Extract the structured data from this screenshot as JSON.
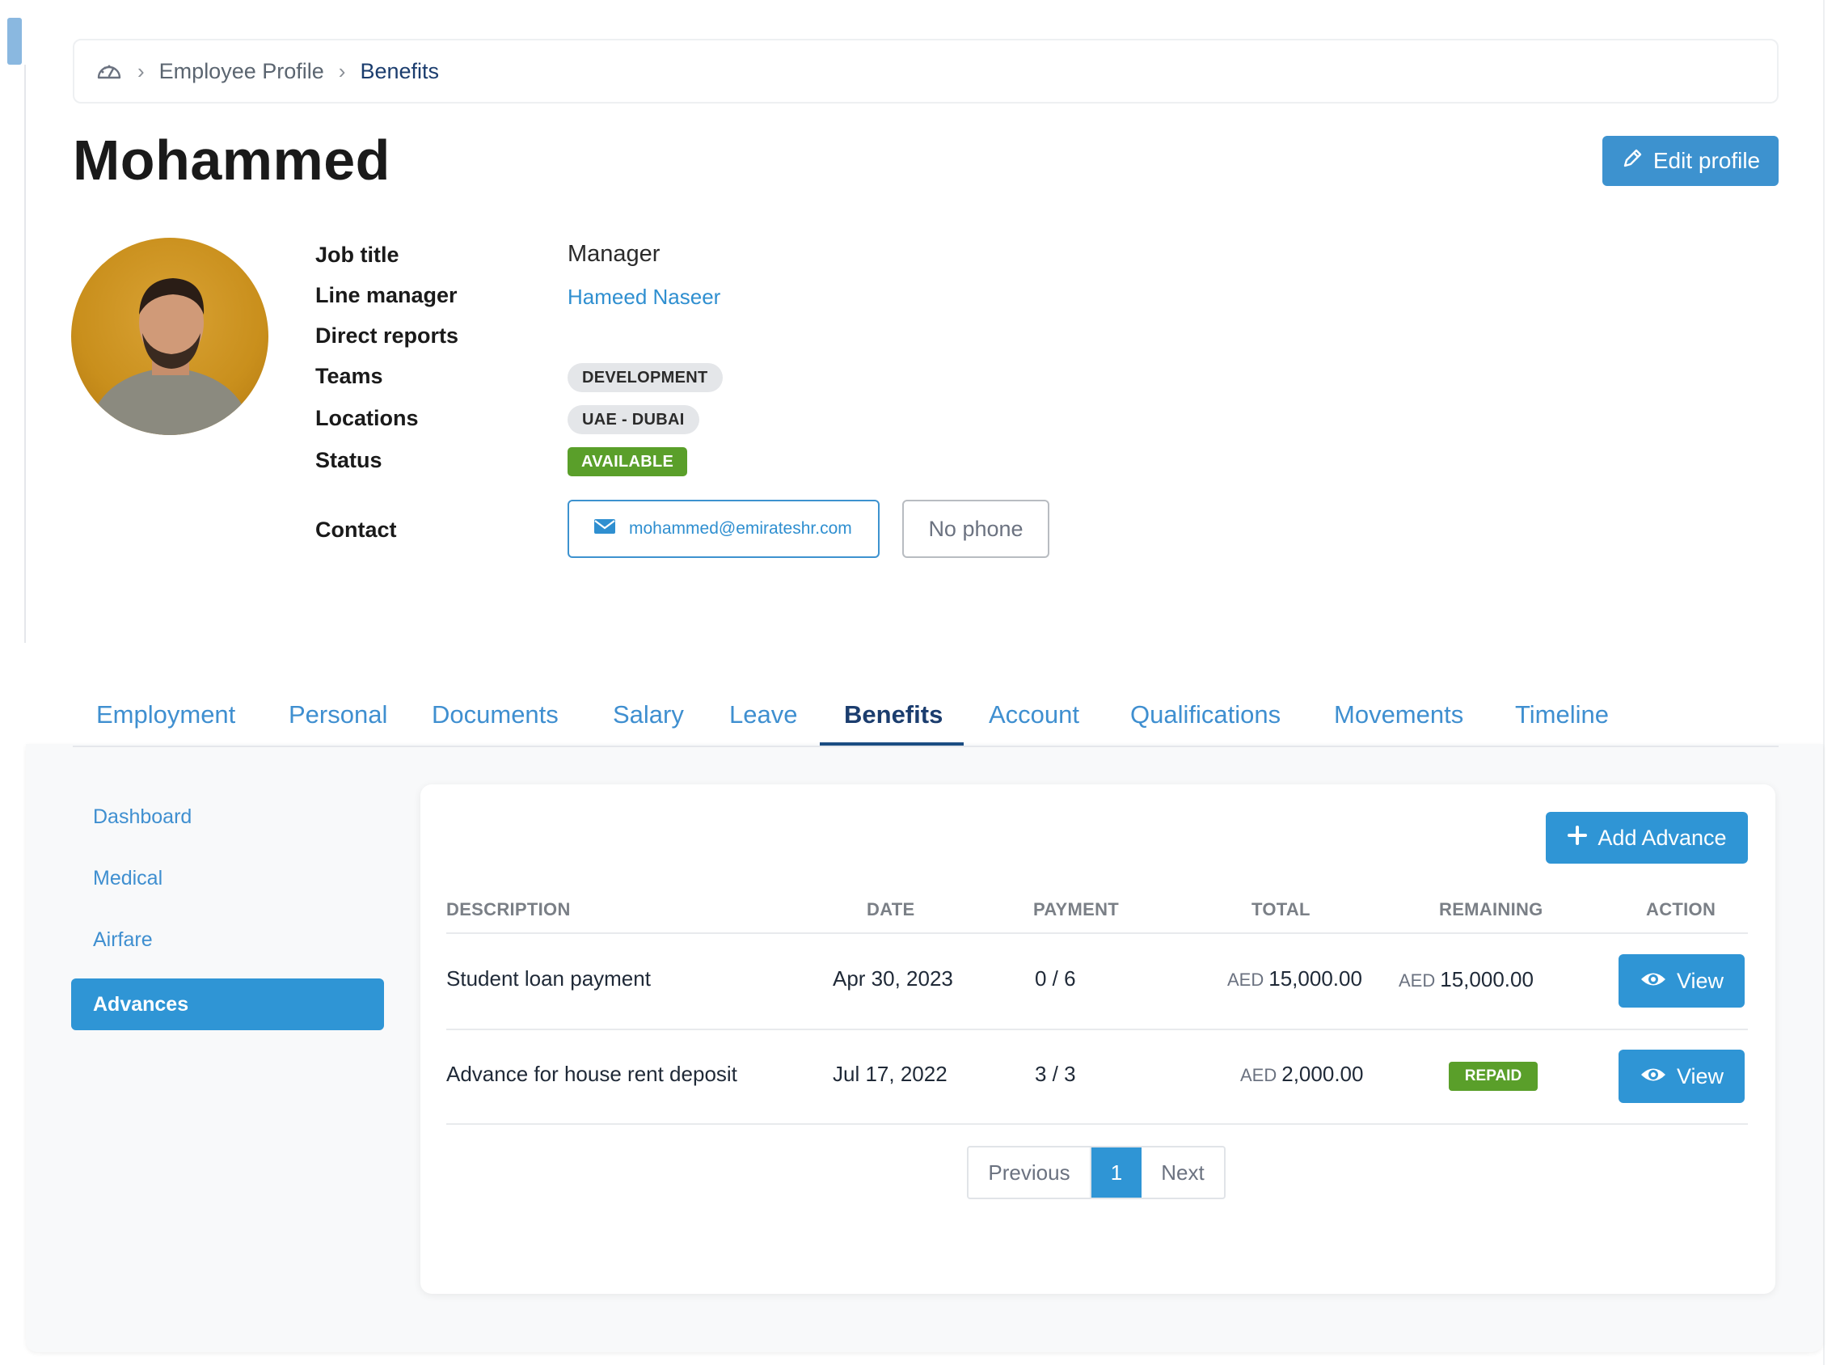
{
  "breadcrumb": {
    "home_icon": "dashboard-gauge-icon",
    "items": [
      "Employee Profile",
      "Benefits"
    ]
  },
  "profile": {
    "name": "Mohammed",
    "edit_label": "Edit profile",
    "labels": {
      "job_title": "Job title",
      "line_manager": "Line manager",
      "direct_reports": "Direct reports",
      "teams": "Teams",
      "locations": "Locations",
      "status": "Status",
      "contact": "Contact"
    },
    "values": {
      "job_title": "Manager",
      "line_manager": "Hameed Naseer",
      "teams": "DEVELOPMENT",
      "locations": "UAE - DUBAI",
      "status": "AVAILABLE",
      "email": "mohammed@emirateshr.com",
      "phone": "No phone"
    }
  },
  "tabs": [
    {
      "label": "Employment"
    },
    {
      "label": "Personal"
    },
    {
      "label": "Documents"
    },
    {
      "label": "Salary"
    },
    {
      "label": "Leave"
    },
    {
      "label": "Benefits",
      "active": true
    },
    {
      "label": "Account"
    },
    {
      "label": "Qualifications"
    },
    {
      "label": "Movements"
    },
    {
      "label": "Timeline"
    }
  ],
  "sidenav": {
    "items": [
      "Dashboard",
      "Medical",
      "Airfare",
      "Advances"
    ],
    "active": "Advances"
  },
  "advances": {
    "add_label": "Add Advance",
    "columns": [
      "DESCRIPTION",
      "DATE",
      "PAYMENT",
      "TOTAL",
      "REMAINING",
      "ACTION"
    ],
    "currency": "AED",
    "rows": [
      {
        "description": "Student loan payment",
        "date": "Apr 30, 2023",
        "payment": "0 / 6",
        "total": "15,000.00",
        "remaining": "15,000.00",
        "action": "View"
      },
      {
        "description": "Advance for house rent deposit",
        "date": "Jul 17, 2022",
        "payment": "3 / 3",
        "total": "2,000.00",
        "remaining_badge": "REPAID",
        "action": "View"
      }
    ]
  },
  "pagination": {
    "previous": "Previous",
    "current": "1",
    "next": "Next"
  },
  "colors": {
    "primary": "#2f95d5",
    "success": "#5a9f2a",
    "title_dark": "#1b3d6e"
  }
}
